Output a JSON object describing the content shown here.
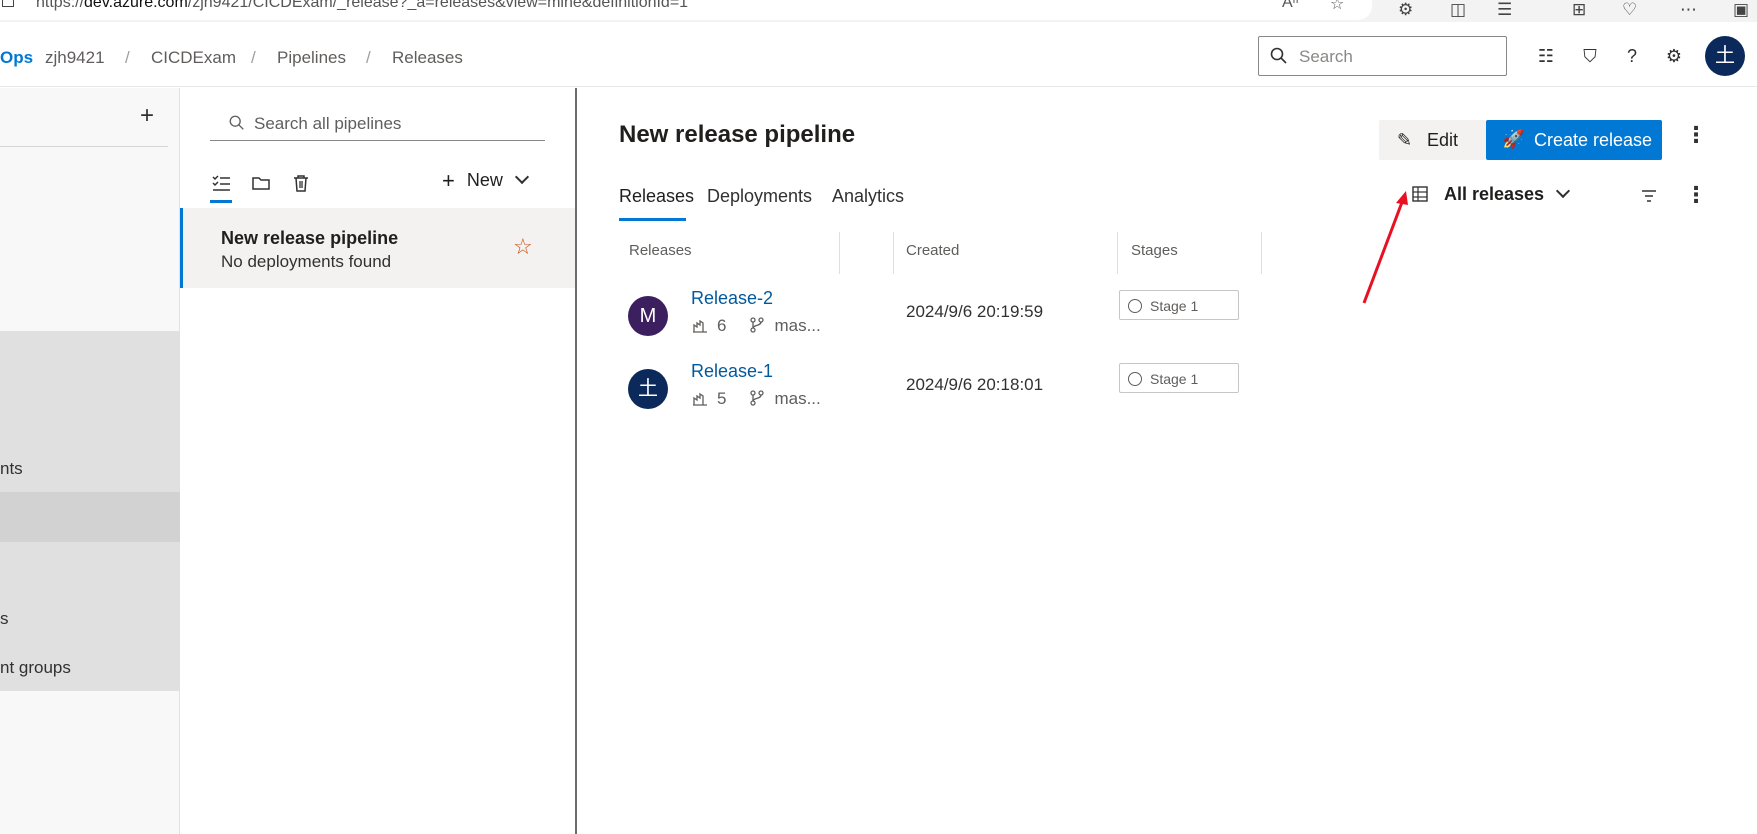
{
  "browser": {
    "url_prefix": "https://",
    "url_domain": "dev.azure.com",
    "url_path": "/zjh9421/CICDExam/_release?_a=releases&view=mine&definitionId=1",
    "read_aloud_icon": "read-aloud-icon",
    "favorite_icon": "star-icon"
  },
  "header": {
    "brand": "Ops",
    "breadcrumb": [
      "zjh9421",
      "CICDExam",
      "Pipelines",
      "Releases"
    ],
    "search_placeholder": "Search",
    "avatar_initial": "土"
  },
  "leftnav": {
    "items": [
      "nts",
      "s",
      "nt groups"
    ]
  },
  "pipelines_panel": {
    "search_placeholder": "Search all pipelines",
    "new_label": "New",
    "selected_pipeline": {
      "title": "New release pipeline",
      "subtitle": "No deployments found"
    }
  },
  "main": {
    "title": "New release pipeline",
    "edit_label": "Edit",
    "create_release_label": "Create release",
    "tabs": [
      {
        "label": "Releases",
        "active": true
      },
      {
        "label": "Deployments",
        "active": false
      },
      {
        "label": "Analytics",
        "active": false
      }
    ],
    "view_filter_label": "All releases",
    "table": {
      "columns": [
        "Releases",
        "Created",
        "Stages"
      ],
      "rows": [
        {
          "avatar": "M",
          "avatar_color": "#3b1f5e",
          "name": "Release-2",
          "build": "6",
          "branch": "mas...",
          "created": "2024/9/6 20:19:59",
          "stage": "Stage 1"
        },
        {
          "avatar": "土",
          "avatar_color": "#0b2a5b",
          "name": "Release-1",
          "build": "5",
          "branch": "mas...",
          "created": "2024/9/6 20:18:01",
          "stage": "Stage 1"
        }
      ]
    }
  },
  "colors": {
    "accent": "#0078d4",
    "link": "#005a9e",
    "annotation": "#e81123"
  }
}
